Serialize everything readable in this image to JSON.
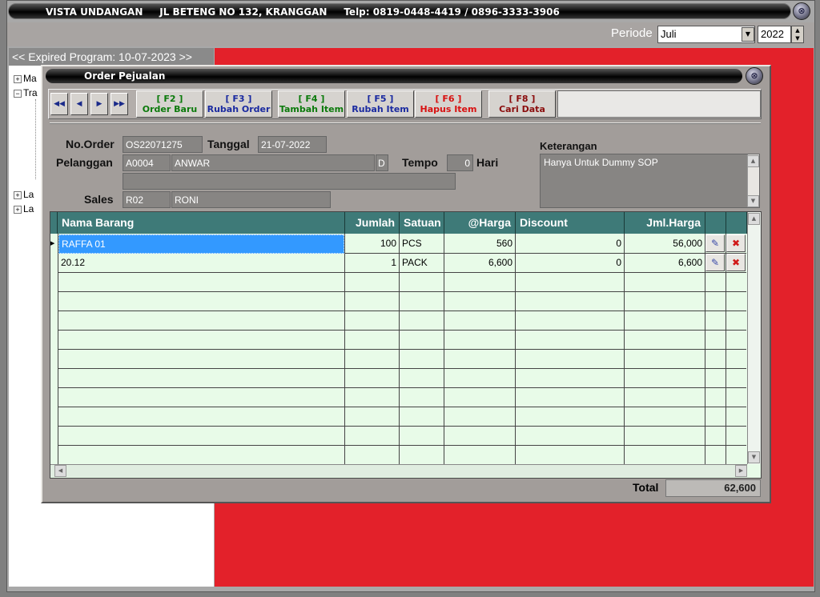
{
  "app": {
    "title": "VISTA UNDANGAN     JL BETENG NO 132, KRANGGAN     Telp: 0819-0448-4419 / 0896-3333-3906",
    "close_glyph": "⊗"
  },
  "periode": {
    "label": "Periode",
    "month": "Juli",
    "year": "2022"
  },
  "expired": "<< Expired Program: 10-07-2023 >>",
  "tree": {
    "items": [
      "Ma",
      "Tra",
      "La",
      "La"
    ]
  },
  "child": {
    "title": "Order Pejualan"
  },
  "toolbar": {
    "f2_key": "[ F2 ]",
    "f2_label": "Order Baru",
    "f3_key": "[ F3 ]",
    "f3_label": "Rubah Order",
    "f4_key": "[ F4 ]",
    "f4_label": "Tambah Item",
    "f5_key": "[ F5 ]",
    "f5_label": "Rubah Item",
    "f6_key": "[ F6 ]",
    "f6_label": "Hapus Item",
    "f8_key": "[ F8 ]",
    "f8_label": "Cari Data"
  },
  "form": {
    "no_order_label": "No.Order",
    "no_order": "OS22071275",
    "tanggal_label": "Tanggal",
    "tanggal": "21-07-2022",
    "pelanggan_label": "Pelanggan",
    "pelanggan_code": "A0004",
    "pelanggan_name": "ANWAR",
    "pelanggan_flag": "D",
    "tempo_label": "Tempo",
    "tempo": "0",
    "hari_label": "Hari",
    "sales_label": "Sales",
    "sales_code": "R02",
    "sales_name": "RONI",
    "keterangan_label": "Keterangan",
    "keterangan": "Hanya Untuk Dummy SOP"
  },
  "grid": {
    "headers": [
      "Nama Barang",
      "Jumlah",
      "Satuan",
      "@Harga",
      "Discount",
      "Jml.Harga"
    ],
    "rows": [
      {
        "nama": "RAFFA 01",
        "jumlah": "100",
        "satuan": "PCS",
        "harga": "560",
        "discount": "0",
        "jml": "56,000"
      },
      {
        "nama": "20.12",
        "jumlah": "1",
        "satuan": "PACK",
        "harga": "6,600",
        "discount": "0",
        "jml": "6,600"
      }
    ]
  },
  "total": {
    "label": "Total",
    "value": "62,600"
  },
  "colors": {
    "header_teal": "#3e7a78",
    "background_red": "#e3212a",
    "grid_bg": "#e8fbe8",
    "selection_blue": "#3399ff"
  }
}
